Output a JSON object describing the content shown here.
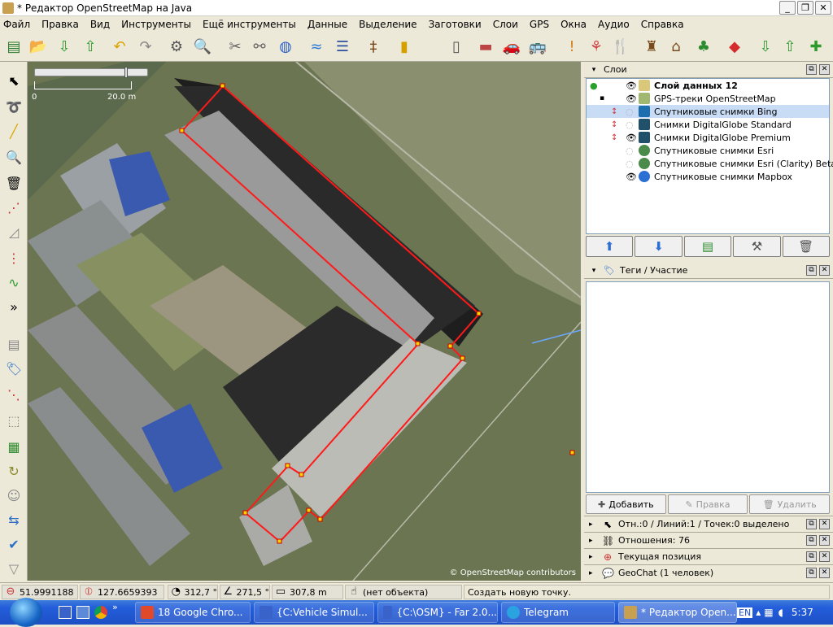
{
  "window": {
    "title": "* Редактор OpenStreetMap на Java"
  },
  "menu": [
    "Файл",
    "Правка",
    "Вид",
    "Инструменты",
    "Ещё инструменты",
    "Данные",
    "Выделение",
    "Заготовки",
    "Слои",
    "GPS",
    "Окна",
    "Аудио",
    "Справка"
  ],
  "map": {
    "scale_left": "0",
    "scale_right": "20.0 m",
    "attribution": "© OpenStreetMap contributors"
  },
  "layers_panel": {
    "title": "Слои",
    "items": [
      {
        "name": "Слой данных 12",
        "bold": true,
        "visible": true,
        "icon": "data-layer-icon"
      },
      {
        "name": "GPS-треки OpenStreetMap",
        "visible": true,
        "icon": "gps-icon"
      },
      {
        "name": "Спутниковые снимки Bing",
        "visible": false,
        "selected": true,
        "icon": "bing-icon"
      },
      {
        "name": "Снимки DigitalGlobe Standard",
        "visible": false,
        "icon": "digitalglobe-icon"
      },
      {
        "name": "Снимки DigitalGlobe Premium",
        "visible": true,
        "icon": "digitalglobe-icon"
      },
      {
        "name": "Спутниковые снимки Esri",
        "visible": false,
        "icon": "esri-icon"
      },
      {
        "name": "Спутниковые снимки Esri (Clarity) Beta",
        "visible": false,
        "icon": "esri-icon"
      },
      {
        "name": "Спутниковые снимки Mapbox",
        "visible": true,
        "icon": "mapbox-icon"
      }
    ]
  },
  "tags_panel": {
    "title": "Теги / Участие",
    "add_label": "Добавить",
    "edit_label": "Правка",
    "delete_label": "Удалить"
  },
  "mini_panels": [
    {
      "label": "Отн.:0 / Линий:1 / Точек:0 выделено",
      "icon": "selection-icon"
    },
    {
      "label": "Отношения: 76",
      "icon": "relation-icon"
    },
    {
      "label": "Текущая позиция",
      "icon": "crosshair-icon"
    },
    {
      "label": "GeoChat (1 человек)",
      "icon": "chat-icon"
    }
  ],
  "status": {
    "lat": "51.9991188",
    "lon": "127.6659393",
    "heading": "312,7 °",
    "angle": "271,5 °",
    "distance": "307,8 m",
    "object": "(нет объекта)",
    "message": "Создать новую точку."
  },
  "taskbar": {
    "tasks": [
      {
        "label": "18  Google Chro...",
        "color": "#e04a2a"
      },
      {
        "label": "{C:Vehicle Simul...",
        "color": "#3a63c9"
      },
      {
        "label": "{C:\\OSM} - Far 2.0...",
        "color": "#3a63c9"
      },
      {
        "label": "Telegram",
        "color": "#2aa3e0"
      },
      {
        "label": "* Редактор Open...",
        "color": "#c8a050"
      }
    ],
    "lang": "EN",
    "time": "5:37"
  }
}
